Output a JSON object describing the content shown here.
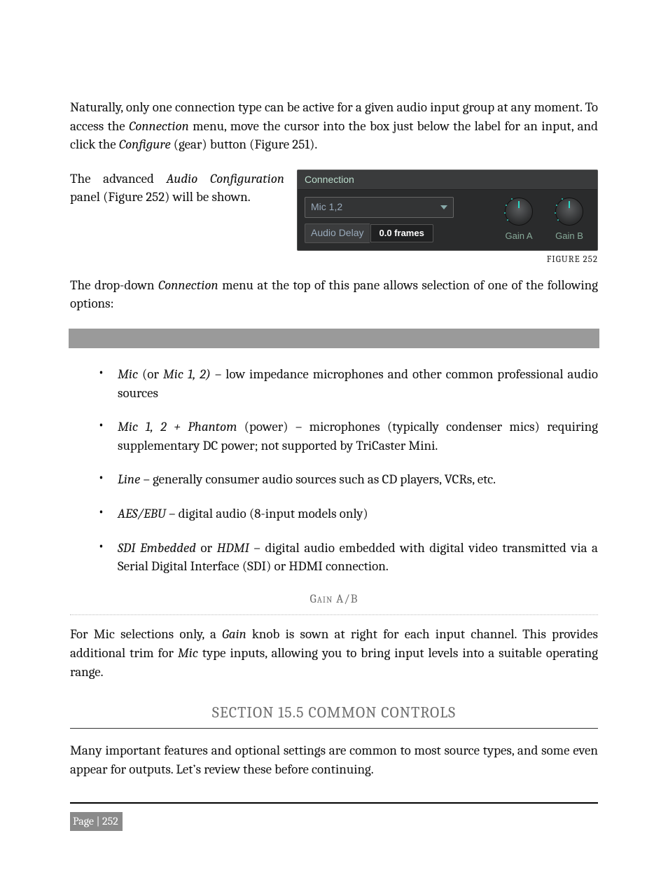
{
  "intro_a": "Naturally, only one connection type can be active for a given audio input group at any moment. To access the ",
  "intro_b_i": "Connection",
  "intro_c": " menu, move the cursor into the box just below the label for an input, and click the ",
  "intro_d_i": "Configure",
  "intro_e": " (gear) button (Figure 251).",
  "left_a": "The advanced ",
  "left_b_i": "Audio Configuration",
  "left_c": " panel (Figure 252) will be shown.",
  "panel": {
    "title": "Connection",
    "dropdown_value": "Mic 1,2",
    "audio_delay_label": "Audio Delay",
    "audio_delay_value": "0.0 frames",
    "gain_a": "Gain A",
    "gain_b": "Gain B"
  },
  "figure_caption": "FIGURE 252",
  "dd_a": "The drop-down ",
  "dd_b_i": "Connection",
  "dd_c": " menu at the top of this pane allows selection of one of the following options:",
  "opts": {
    "mic_a_i": "Mic",
    "mic_b": " (or ",
    "mic_c_i": "Mic 1, 2)",
    "mic_d": " – low impedance microphones and other common professional audio sources",
    "phantom_a_i": "Mic 1, 2 + Phantom",
    "phantom_b": " (power) – microphones (typically condenser mics) requiring supplementary DC power; not supported by TriCaster Mini.",
    "line_a_i": "Line",
    "line_b": " – generally consumer audio sources such as CD players, VCRs, etc.",
    "aes_a_i": "AES/EBU",
    "aes_b": " – digital audio (8-input models only)",
    "sdi_a_i": "SDI Embedded",
    "sdi_b": " or ",
    "sdi_c_i": "HDMI",
    "sdi_d": " – digital audio embedded with digital video transmitted via a Serial Digital Interface (SDI) or HDMI connection."
  },
  "gain_heading": "Gain A/B",
  "gain_a": "For Mic selections only, a ",
  "gain_b_i": "Gain",
  "gain_c": " knob is sown at right for each input channel.  This provides additional trim for ",
  "gain_d_i": "Mic",
  "gain_e": " type inputs, allowing you to bring input levels into a suitable operating range.",
  "section_heading": "SECTION 15.5 COMMON CONTROLS",
  "closing": "Many important features and optional settings are common to most source types, and some even appear for outputs.  Let’s review these before continuing.",
  "page_number": "Page | 252"
}
